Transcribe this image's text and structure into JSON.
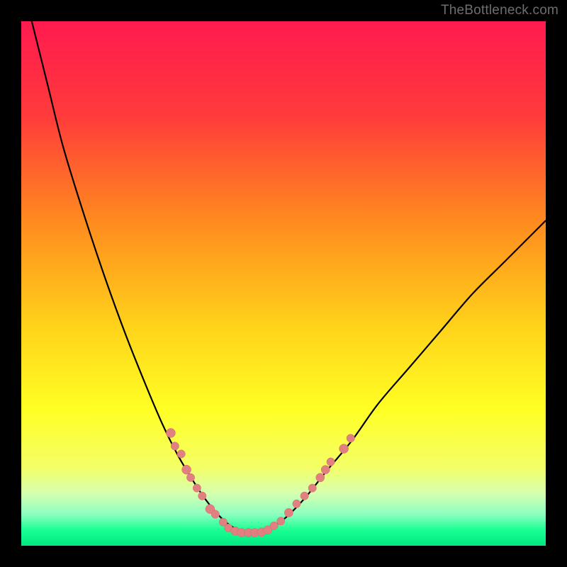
{
  "watermark": "TheBottleneck.com",
  "colors": {
    "frame": "#000000",
    "gradient_stops": [
      {
        "offset": 0.0,
        "color": "#ff1a4f"
      },
      {
        "offset": 0.18,
        "color": "#ff3b3b"
      },
      {
        "offset": 0.38,
        "color": "#ff8a1f"
      },
      {
        "offset": 0.58,
        "color": "#ffd21a"
      },
      {
        "offset": 0.74,
        "color": "#ffff24"
      },
      {
        "offset": 0.85,
        "color": "#f4ff66"
      },
      {
        "offset": 0.9,
        "color": "#d7ffb0"
      },
      {
        "offset": 0.94,
        "color": "#8cffc0"
      },
      {
        "offset": 0.97,
        "color": "#1aff94"
      },
      {
        "offset": 1.0,
        "color": "#00e880"
      }
    ],
    "curve": "#000000",
    "marker_fill": "#e08080",
    "marker_stroke": "#d46a6a"
  },
  "chart_data": {
    "type": "line",
    "title": "",
    "xlabel": "",
    "ylabel": "",
    "xlim": [
      0,
      100
    ],
    "ylim": [
      0,
      100
    ],
    "series": [
      {
        "name": "bottleneck-curve",
        "x": [
          2,
          5,
          8,
          12,
          16,
          20,
          24,
          27,
          30,
          33,
          35,
          37,
          39,
          41,
          43,
          45,
          47,
          50,
          54,
          58,
          63,
          68,
          74,
          80,
          86,
          92,
          98,
          100
        ],
        "y": [
          100,
          88,
          76,
          63,
          51,
          40,
          30,
          23,
          17,
          12,
          9,
          6.5,
          4.5,
          3.2,
          2.5,
          2.5,
          3.2,
          5,
          9,
          14,
          20,
          27,
          34,
          41,
          48,
          54,
          60,
          62
        ]
      }
    ],
    "markers": [
      {
        "x": 28.5,
        "y": 21.5,
        "r": 1.6
      },
      {
        "x": 29.3,
        "y": 19.0,
        "r": 1.4
      },
      {
        "x": 30.5,
        "y": 17.5,
        "r": 1.4
      },
      {
        "x": 31.5,
        "y": 14.5,
        "r": 1.6
      },
      {
        "x": 32.3,
        "y": 13.0,
        "r": 1.4
      },
      {
        "x": 33.5,
        "y": 11.0,
        "r": 1.4
      },
      {
        "x": 34.5,
        "y": 9.5,
        "r": 1.4
      },
      {
        "x": 36.0,
        "y": 7.0,
        "r": 1.6
      },
      {
        "x": 37.0,
        "y": 6.0,
        "r": 1.4
      },
      {
        "x": 38.5,
        "y": 4.5,
        "r": 1.4
      },
      {
        "x": 39.5,
        "y": 3.4,
        "r": 1.4
      },
      {
        "x": 40.8,
        "y": 2.8,
        "r": 1.5
      },
      {
        "x": 42.0,
        "y": 2.5,
        "r": 1.5
      },
      {
        "x": 43.3,
        "y": 2.5,
        "r": 1.5
      },
      {
        "x": 44.5,
        "y": 2.5,
        "r": 1.5
      },
      {
        "x": 45.8,
        "y": 2.6,
        "r": 1.5
      },
      {
        "x": 47.0,
        "y": 3.0,
        "r": 1.5
      },
      {
        "x": 48.2,
        "y": 3.8,
        "r": 1.4
      },
      {
        "x": 49.5,
        "y": 4.7,
        "r": 1.4
      },
      {
        "x": 51.0,
        "y": 6.3,
        "r": 1.5
      },
      {
        "x": 52.5,
        "y": 8.0,
        "r": 1.4
      },
      {
        "x": 54.0,
        "y": 9.5,
        "r": 1.4
      },
      {
        "x": 55.5,
        "y": 11.0,
        "r": 1.4
      },
      {
        "x": 57.0,
        "y": 13.0,
        "r": 1.5
      },
      {
        "x": 58.0,
        "y": 14.5,
        "r": 1.5
      },
      {
        "x": 59.0,
        "y": 16.0,
        "r": 1.4
      },
      {
        "x": 61.5,
        "y": 18.5,
        "r": 1.6
      },
      {
        "x": 62.8,
        "y": 20.5,
        "r": 1.4
      }
    ]
  }
}
